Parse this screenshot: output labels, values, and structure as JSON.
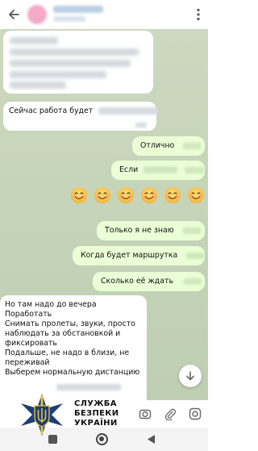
{
  "chat": {
    "messages": [
      {
        "direction": "in",
        "text": "Сейчас работа будет"
      },
      {
        "direction": "out",
        "text": "Отлично"
      },
      {
        "direction": "out",
        "text": "Если"
      },
      {
        "direction": "out",
        "text": "Только я не знаю"
      },
      {
        "direction": "out",
        "text": "Когда будет маршрутка"
      },
      {
        "direction": "out",
        "text": "Сколько её ждать"
      }
    ],
    "long_message_lines": [
      "Но там надо до вечера",
      " Поработать",
      "Снимать пролеты, звуки, просто",
      "наблюдать за обстановкой и",
      "фиксировать",
      " Подальше, не надо в близи, не",
      "переживай",
      "Выберем нормальную дистанцию"
    ],
    "emoji_count": 6
  },
  "watermark": {
    "line1": "СЛУЖБА",
    "line2": "БЕЗПЕКИ",
    "line3": "УКРАЇНИ"
  },
  "colors": {
    "incoming_bubble": "#ffffff",
    "outgoing_bubble": "#eaffd6",
    "wallpaper": "#c9d6bc"
  }
}
